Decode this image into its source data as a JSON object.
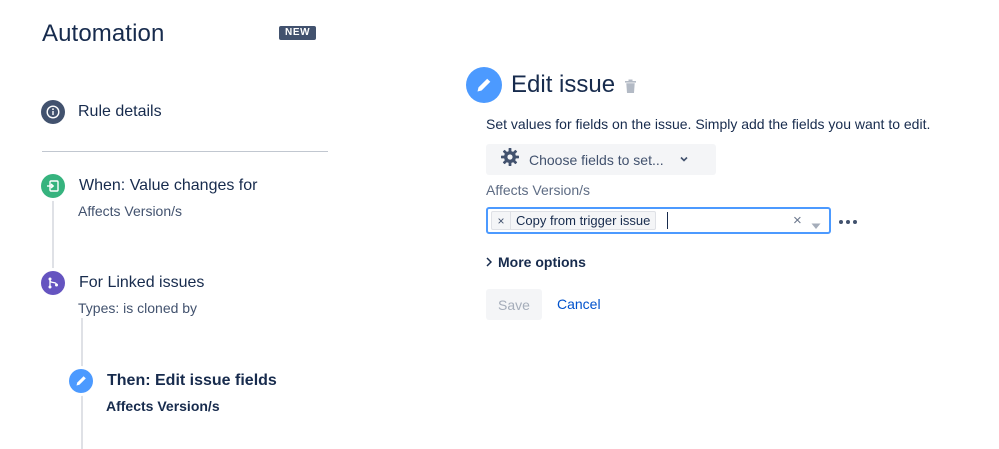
{
  "sidebar": {
    "title": "Automation",
    "badge": "NEW",
    "rule_details": "Rule details",
    "trigger": {
      "title": "When: Value changes for",
      "subtitle": "Affects Version/s"
    },
    "branch": {
      "title": "For Linked issues",
      "subtitle": "Types: is cloned by"
    },
    "action": {
      "title": "Then: Edit issue fields",
      "subtitle": "Affects Version/s"
    }
  },
  "editor": {
    "title": "Edit issue",
    "description": "Set values for fields on the issue. Simply add the fields you want to edit.",
    "choose_fields_label": "Choose fields to set...",
    "field_label": "Affects Version/s",
    "selected_tag": "Copy from trigger issue",
    "tag_remove": "×",
    "clear_symbol": "×",
    "more_options": "More options",
    "save_label": "Save",
    "cancel_label": "Cancel"
  },
  "colors": {
    "accent_blue": "#4c9aff",
    "link_blue": "#0052cc",
    "trigger_green": "#36b37e",
    "branch_purple": "#6554c0",
    "info_navy": "#42526e",
    "text_dark": "#172b4d"
  },
  "icons": {
    "rule_details": "info-icon",
    "trigger": "trigger-icon",
    "branch": "branch-icon",
    "action": "pencil-icon",
    "editor": "pencil-icon",
    "delete": "trash-icon",
    "choose_fields": "gear-icon",
    "more": "more-dots-icon"
  }
}
